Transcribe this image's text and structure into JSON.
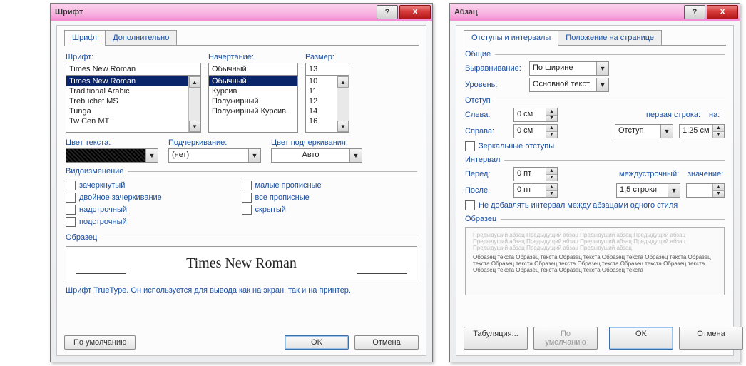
{
  "font_dialog": {
    "title": "Шрифт",
    "tabs": {
      "font": "Шрифт",
      "advanced": "Дополнительно"
    },
    "labels": {
      "font": "Шрифт:",
      "style": "Начертание:",
      "size": "Размер:",
      "font_color": "Цвет текста:",
      "underline": "Подчеркивание:",
      "underline_color": "Цвет подчеркивания:",
      "effects": "Видоизменение",
      "sample": "Образец"
    },
    "font_value": "Times New Roman",
    "font_list": [
      "Times New Roman",
      "Traditional Arabic",
      "Trebuchet MS",
      "Tunga",
      "Tw Cen MT"
    ],
    "style_value": "Обычный",
    "style_list": [
      "Обычный",
      "Курсив",
      "Полужирный",
      "Полужирный Курсив"
    ],
    "size_value": "13",
    "size_list": [
      "10",
      "11",
      "12",
      "14",
      "16"
    ],
    "underline_value": "(нет)",
    "underline_color_value": "Авто",
    "effects": {
      "strike": "зачеркнутый",
      "dstrike": "двойное зачеркивание",
      "super": "надстрочный",
      "sub": "подстрочный",
      "smallcaps": "малые прописные",
      "allcaps": "все прописные",
      "hidden": "скрытый"
    },
    "sample_text": "Times New Roman",
    "footer_note": "Шрифт TrueType. Он используется для вывода как на экран, так и на принтер.",
    "buttons": {
      "default": "По умолчанию",
      "ok": "OK",
      "cancel": "Отмена"
    }
  },
  "para_dialog": {
    "title": "Абзац",
    "tabs": {
      "indents": "Отступы и интервалы",
      "position": "Положение на странице"
    },
    "groups": {
      "general": "Общие",
      "indent": "Отступ",
      "spacing": "Интервал",
      "sample": "Образец"
    },
    "labels": {
      "alignment": "Выравнивание:",
      "level": "Уровень:",
      "left": "Слева:",
      "right": "Справа:",
      "firstline": "первая строка:",
      "by": "на:",
      "before": "Перед:",
      "after": "После:",
      "linespace": "междустрочный:",
      "value": "значение:"
    },
    "alignment_value": "По ширине",
    "level_value": "Основной текст",
    "left_value": "0 см",
    "right_value": "0 см",
    "firstline_value": "Отступ",
    "by_value": "1,25 см",
    "mirror": "Зеркальные отступы",
    "before_value": "0 пт",
    "after_value": "0 пт",
    "linespace_value": "1,5 строки",
    "value_value": "",
    "no_space_same": "Не добавлять интервал между абзацами одного стиля",
    "sample_grey": "Предыдущий абзац Предыдущий абзац Предыдущий абзац Предыдущий абзац Предыдущий абзац Предыдущий абзац Предыдущий абзац Предыдущий абзац Предыдущий абзац Предыдущий абзац Предыдущий абзац",
    "sample_dark": "Образец текста Образец текста Образец текста Образец текста Образец текста Образец текста Образец текста Образец текста Образец текста Образец текста Образец текста Образец текста Образец текста Образец текста Образец текста",
    "buttons": {
      "tabs": "Табуляция...",
      "default": "По умолчанию",
      "ok": "OK",
      "cancel": "Отмена"
    }
  }
}
